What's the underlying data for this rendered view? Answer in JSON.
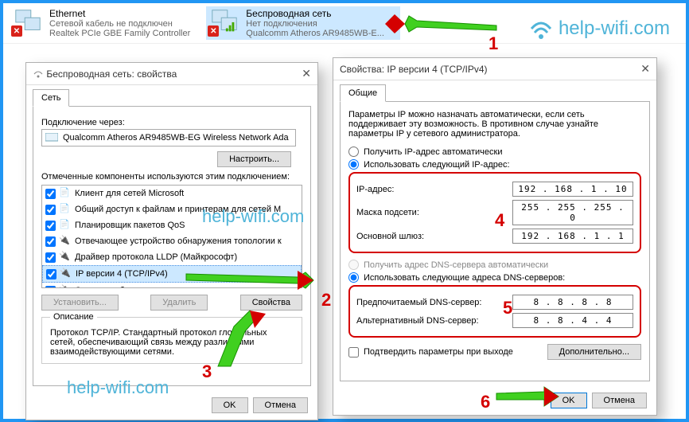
{
  "watermark": "help-wifi.com",
  "adapters": {
    "ethernet": {
      "title": "Ethernet",
      "sub1": "Сетевой кабель не подключен",
      "sub2": "Realtek PCIe GBE Family Controller"
    },
    "wifi": {
      "title": "Беспроводная сеть",
      "sub1": "Нет подключения",
      "sub2": "Qualcomm Atheros AR9485WB-E..."
    }
  },
  "dlg1": {
    "title": "Беспроводная сеть: свойства",
    "tab": "Сеть",
    "connection_label": "Подключение через:",
    "adapter_name": "Qualcomm Atheros AR9485WB-EG Wireless Network Ada",
    "configure_btn": "Настроить...",
    "components_label": "Отмеченные компоненты используются этим подключением:",
    "components": [
      {
        "label": "Клиент для сетей Microsoft"
      },
      {
        "label": "Общий доступ к файлам и принтерам для сетей М"
      },
      {
        "label": "Планировщик пакетов QoS"
      },
      {
        "label": "Отвечающее устройство обнаружения топологии к"
      },
      {
        "label": "Драйвер протокола LLDP (Майкрософт)"
      },
      {
        "label": "IP версии 4 (TCP/IPv4)"
      },
      {
        "label": "Ответчик обнаружения топологии канального уров"
      }
    ],
    "install_btn": "Установить...",
    "uninstall_btn": "Удалить",
    "props_btn": "Свойства",
    "desc_title": "Описание",
    "desc_body": "Протокол TCP/IP. Стандартный протокол глобальных сетей, обеспечивающий связь между различными взаимодействующими сетями.",
    "ok": "OK",
    "cancel": "Отмена"
  },
  "dlg2": {
    "title": "Свойства: IP версии 4 (TCP/IPv4)",
    "tab": "Общие",
    "intro": "Параметры IP можно назначать автоматически, если сеть поддерживает эту возможность. В противном случае узнайте параметры IP у сетевого администратора.",
    "radio_auto_ip": "Получить IP-адрес автоматически",
    "radio_manual_ip": "Использовать следующий IP-адрес:",
    "ip_label": "IP-адрес:",
    "mask_label": "Маска подсети:",
    "gw_label": "Основной шлюз:",
    "ip_value": "192 . 168 .  1  . 10",
    "mask_value": "255 . 255 . 255 .  0",
    "gw_value": "192 . 168 .  1  .  1",
    "radio_auto_dns": "Получить адрес DNS-сервера автоматически",
    "radio_manual_dns": "Использовать следующие адреса DNS-серверов:",
    "dns1_label": "Предпочитаемый DNS-сервер:",
    "dns2_label": "Альтернативный DNS-сервер:",
    "dns1_value": "8  .  8  .  8  .  8",
    "dns2_value": "8  .  8  .  4  .  4",
    "confirm_label": "Подтвердить параметры при выходе",
    "advanced_btn": "Дополнительно...",
    "ok": "OK",
    "cancel": "Отмена"
  },
  "annotations": {
    "n1": "1",
    "n2": "2",
    "n3": "3",
    "n4": "4",
    "n5": "5",
    "n6": "6"
  }
}
